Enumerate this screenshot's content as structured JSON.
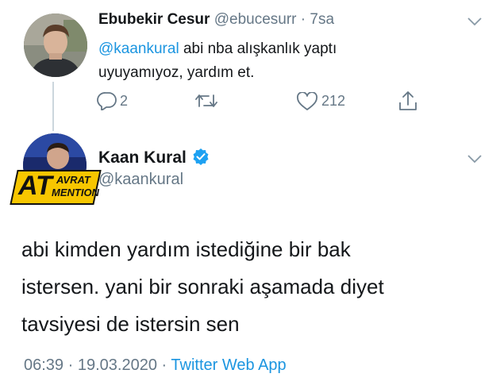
{
  "reply_to": {
    "display_name": "Ebubekir Cesur",
    "handle": "@ebucesurr",
    "separator": "·",
    "time_ago": "7sa",
    "mention": "@kaankural",
    "text_line1": " abi nba alışkanlık yaptı",
    "text_line2": "uyuyamıyoz, yardım et.",
    "actions": {
      "reply_count": "2",
      "retweet_count": "",
      "like_count": "212"
    }
  },
  "main_tweet": {
    "display_name": "Kaan Kural",
    "handle": "@kaankural",
    "verified": true,
    "text_lines": [
      "abi kimden yardım istediğine bir bak",
      "istersen. yani bir sonraki aşamada diyet",
      "tavsiyesi de istersin sen"
    ],
    "time": "06:39",
    "separator1": "·",
    "date": "19.03.2020",
    "separator2": "·",
    "source": "Twitter Web App"
  },
  "watermark": {
    "line1": "AT",
    "line2": "AVRAT",
    "line3": "MENTION"
  },
  "colors": {
    "accent": "#1b95e0",
    "muted": "#657786",
    "text": "#14171a"
  },
  "icons": [
    "reply-icon",
    "retweet-icon",
    "like-icon",
    "share-icon",
    "chevron-down-icon",
    "verified-badge-icon"
  ]
}
